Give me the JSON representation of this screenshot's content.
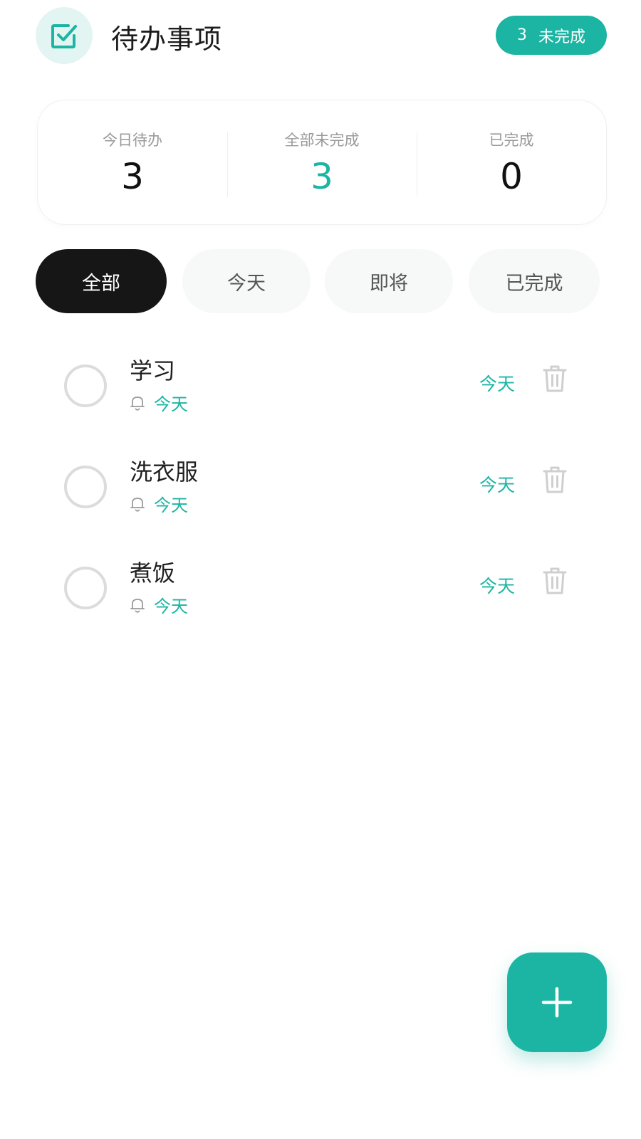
{
  "header": {
    "title": "待办事项",
    "pending_count": "3",
    "pending_label": "未完成"
  },
  "stats": [
    {
      "label": "今日待办",
      "value": "3"
    },
    {
      "label": "全部未完成",
      "value": "3"
    },
    {
      "label": "已完成",
      "value": "0"
    }
  ],
  "tabs": [
    {
      "label": "全部",
      "active": true
    },
    {
      "label": "今天",
      "active": false
    },
    {
      "label": "即将",
      "active": false
    },
    {
      "label": "已完成",
      "active": false
    }
  ],
  "todos": [
    {
      "title": "学习",
      "reminder": "今天",
      "due": "今天"
    },
    {
      "title": "洗衣服",
      "reminder": "今天",
      "due": "今天"
    },
    {
      "title": "煮饭",
      "reminder": "今天",
      "due": "今天"
    }
  ],
  "colors": {
    "accent": "#1cb5a3",
    "active_tab": "#161616",
    "muted_text": "#9a9a9a"
  },
  "icons": {
    "app": "checkbox-icon",
    "reminder": "bell-icon",
    "delete": "trash-icon",
    "add": "plus-icon"
  }
}
